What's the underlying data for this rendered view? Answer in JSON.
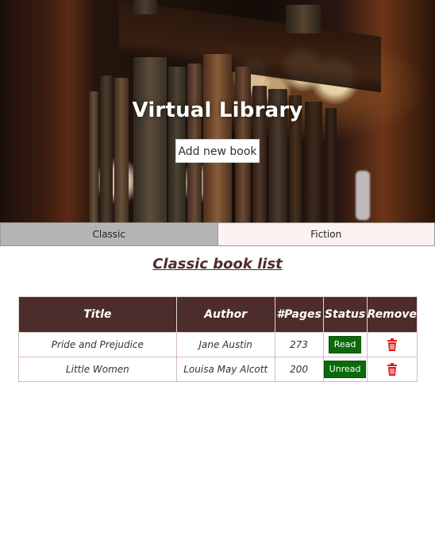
{
  "header": {
    "title": "Virtual Library",
    "add_button_label": "Add new book"
  },
  "tabs": [
    {
      "label": "Classic",
      "selected": true
    },
    {
      "label": "Fiction",
      "selected": false
    }
  ],
  "list_title": "Classic book list",
  "table": {
    "headers": [
      "Title",
      "Author",
      "#Pages",
      "Status",
      "Remove"
    ],
    "rows": [
      {
        "title": "Pride and Prejudice",
        "author": "Jane Austin",
        "pages": "273",
        "status": "Read",
        "remove_icon": "trash-icon"
      },
      {
        "title": "Little Women",
        "author": "Louisa May Alcott",
        "pages": "200",
        "status": "Unread",
        "remove_icon": "trash-icon"
      }
    ]
  },
  "colors": {
    "header_bg": "#4d2c2c",
    "status_green": "#0b6b0b",
    "trash_red": "#e01b1b",
    "tab_selected_bg": "#b5b5b5",
    "tab_unselected_bg": "#fdf2f2"
  }
}
